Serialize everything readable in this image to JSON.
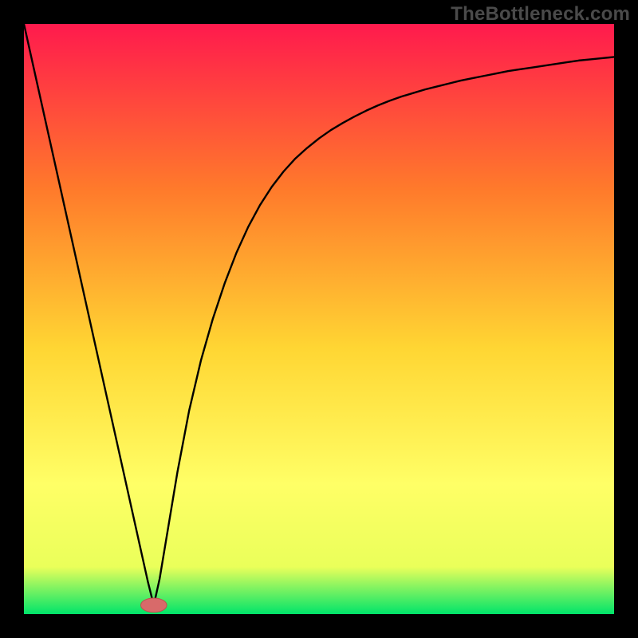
{
  "watermark": "TheBottleneck.com",
  "colors": {
    "frame": "#000000",
    "gradient_top": "#ff1a4d",
    "gradient_mid1": "#ff7a2b",
    "gradient_mid2": "#ffd633",
    "gradient_mid3": "#ffff66",
    "gradient_mid4": "#eaff5a",
    "gradient_bottom": "#00e46a",
    "curve": "#000000",
    "marker_fill": "#d86a6a",
    "marker_stroke": "#c24f4f"
  },
  "chart_data": {
    "type": "line",
    "title": "",
    "xlabel": "",
    "ylabel": "",
    "xlim": [
      0,
      1
    ],
    "ylim": [
      0,
      1
    ],
    "minimum_x": 0.22,
    "marker": {
      "x": 0.22,
      "y": 0.015,
      "rx": 0.022,
      "ry": 0.012
    },
    "series": [
      {
        "name": "curve",
        "points": [
          {
            "x": 0.0,
            "y": 1.0
          },
          {
            "x": 0.02,
            "y": 0.91
          },
          {
            "x": 0.04,
            "y": 0.82
          },
          {
            "x": 0.06,
            "y": 0.73
          },
          {
            "x": 0.08,
            "y": 0.64
          },
          {
            "x": 0.1,
            "y": 0.55
          },
          {
            "x": 0.12,
            "y": 0.46
          },
          {
            "x": 0.14,
            "y": 0.37
          },
          {
            "x": 0.16,
            "y": 0.28
          },
          {
            "x": 0.18,
            "y": 0.19
          },
          {
            "x": 0.2,
            "y": 0.1
          },
          {
            "x": 0.21,
            "y": 0.055
          },
          {
            "x": 0.22,
            "y": 0.015
          },
          {
            "x": 0.23,
            "y": 0.06
          },
          {
            "x": 0.24,
            "y": 0.12
          },
          {
            "x": 0.26,
            "y": 0.24
          },
          {
            "x": 0.28,
            "y": 0.345
          },
          {
            "x": 0.3,
            "y": 0.43
          },
          {
            "x": 0.32,
            "y": 0.5
          },
          {
            "x": 0.34,
            "y": 0.56
          },
          {
            "x": 0.36,
            "y": 0.612
          },
          {
            "x": 0.38,
            "y": 0.656
          },
          {
            "x": 0.4,
            "y": 0.693
          },
          {
            "x": 0.42,
            "y": 0.724
          },
          {
            "x": 0.44,
            "y": 0.75
          },
          {
            "x": 0.46,
            "y": 0.772
          },
          {
            "x": 0.48,
            "y": 0.79
          },
          {
            "x": 0.5,
            "y": 0.806
          },
          {
            "x": 0.52,
            "y": 0.82
          },
          {
            "x": 0.54,
            "y": 0.832
          },
          {
            "x": 0.56,
            "y": 0.843
          },
          {
            "x": 0.58,
            "y": 0.853
          },
          {
            "x": 0.6,
            "y": 0.862
          },
          {
            "x": 0.62,
            "y": 0.87
          },
          {
            "x": 0.64,
            "y": 0.877
          },
          {
            "x": 0.66,
            "y": 0.883
          },
          {
            "x": 0.68,
            "y": 0.889
          },
          {
            "x": 0.7,
            "y": 0.894
          },
          {
            "x": 0.72,
            "y": 0.899
          },
          {
            "x": 0.74,
            "y": 0.904
          },
          {
            "x": 0.76,
            "y": 0.908
          },
          {
            "x": 0.78,
            "y": 0.912
          },
          {
            "x": 0.8,
            "y": 0.916
          },
          {
            "x": 0.82,
            "y": 0.92
          },
          {
            "x": 0.84,
            "y": 0.923
          },
          {
            "x": 0.86,
            "y": 0.926
          },
          {
            "x": 0.88,
            "y": 0.929
          },
          {
            "x": 0.9,
            "y": 0.932
          },
          {
            "x": 0.92,
            "y": 0.935
          },
          {
            "x": 0.94,
            "y": 0.938
          },
          {
            "x": 0.96,
            "y": 0.94
          },
          {
            "x": 0.98,
            "y": 0.942
          },
          {
            "x": 1.0,
            "y": 0.944
          }
        ]
      }
    ]
  }
}
